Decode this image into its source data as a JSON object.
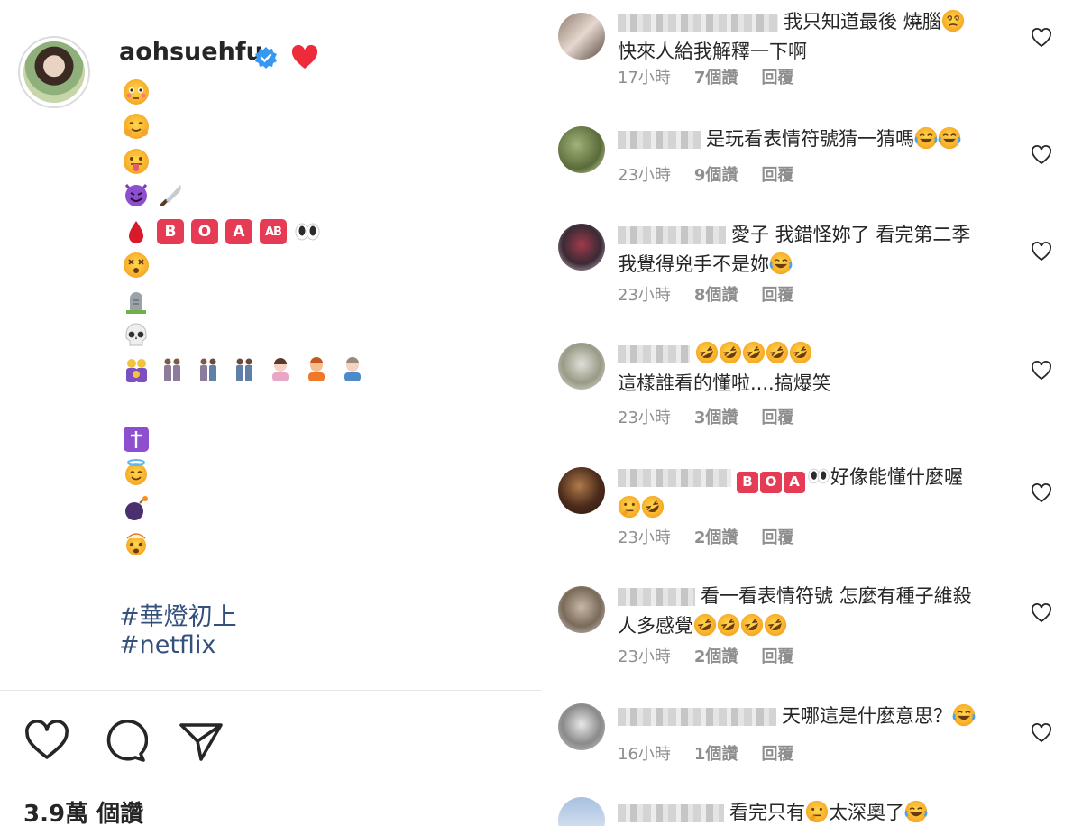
{
  "post": {
    "username": "aohsuehfu",
    "hashtags": [
      "#華燈初上",
      "#netflix"
    ],
    "likes_text": "3.9萬 個讚",
    "blood_types": [
      "B",
      "O",
      "A",
      "AB"
    ]
  },
  "icons": {
    "verified": "verified-badge-icon",
    "like": "heart-outline-icon",
    "comment": "comment-bubble-icon",
    "share": "paper-plane-icon"
  },
  "colors": {
    "verified_blue": "#3897f0",
    "hashtag": "#34507c",
    "meta_gray": "#8e8e8e",
    "blood_box_red": "#e53b55"
  },
  "comments": [
    {
      "text_line1": "我只知道最後 燒腦",
      "text_line2": "快來人給我解釋一下啊",
      "time": "17小時",
      "likes": "7個讚",
      "reply": "回覆"
    },
    {
      "text_line1": "是玩看表情符號猜一猜嗎",
      "time": "23小時",
      "likes": "9個讚",
      "reply": "回覆"
    },
    {
      "text_line1": "愛子 我錯怪妳了 看完第二季",
      "text_line2": "我覺得兇手不是妳",
      "time": "23小時",
      "likes": "8個讚",
      "reply": "回覆"
    },
    {
      "text_line2": "這樣誰看的懂啦....搞爆笑",
      "time": "23小時",
      "likes": "3個讚",
      "reply": "回覆"
    },
    {
      "text_line1": "好像能懂什麼喔",
      "time": "23小時",
      "likes": "2個讚",
      "reply": "回覆",
      "boxes": [
        "B",
        "O",
        "A"
      ]
    },
    {
      "text_line1": "看一看表情符號 怎麼有種子維殺",
      "text_line2": "人多感覺",
      "time": "23小時",
      "likes": "2個讚",
      "reply": "回覆"
    },
    {
      "text_line1": "天哪這是什麼意思？",
      "time": "16小時",
      "likes": "1個讚",
      "reply": "回覆"
    },
    {
      "text_line1": "看完只有",
      "text_line1b": "太深奧了"
    }
  ]
}
